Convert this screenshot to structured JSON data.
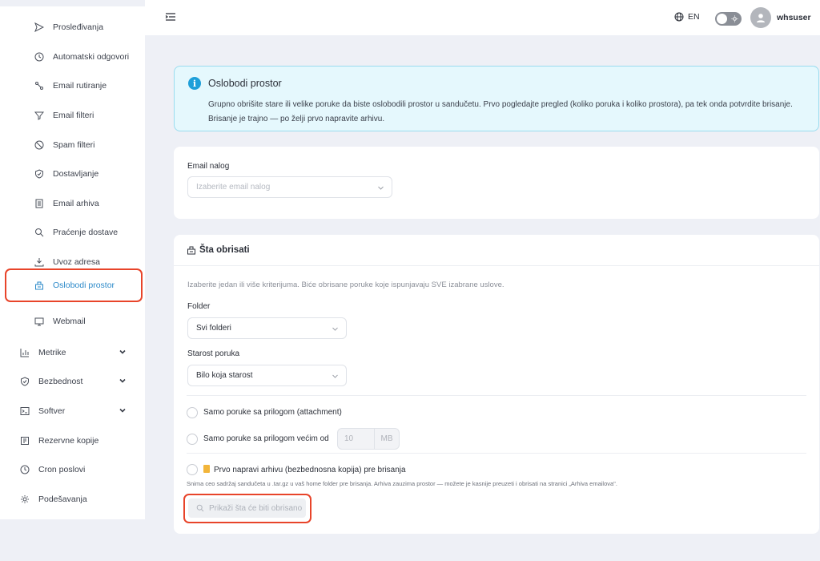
{
  "sidebar": {
    "items": [
      {
        "label": "Prosleđivanja",
        "icon": "send-icon"
      },
      {
        "label": "Automatski odgovori",
        "icon": "clock-icon"
      },
      {
        "label": "Email rutiranje",
        "icon": "route-icon"
      },
      {
        "label": "Email filteri",
        "icon": "filter-icon"
      },
      {
        "label": "Spam filteri",
        "icon": "ban-icon"
      },
      {
        "label": "Dostavljanje",
        "icon": "shield-check-icon"
      },
      {
        "label": "Email arhiva",
        "icon": "archive-icon"
      },
      {
        "label": "Praćenje dostave",
        "icon": "search-icon"
      },
      {
        "label": "Uvoz adresa",
        "icon": "import-icon"
      },
      {
        "label": "Oslobodi prostor",
        "icon": "broom-icon",
        "active": true
      },
      {
        "label": "Webmail",
        "icon": "monitor-icon"
      }
    ],
    "groups": [
      {
        "label": "Metrike",
        "icon": "chart-icon",
        "expandable": true
      },
      {
        "label": "Bezbednost",
        "icon": "shield-icon",
        "expandable": true
      },
      {
        "label": "Softver",
        "icon": "terminal-icon",
        "expandable": true
      },
      {
        "label": "Rezervne kopije",
        "icon": "backup-icon"
      },
      {
        "label": "Cron poslovi",
        "icon": "clock-icon"
      },
      {
        "label": "Podešavanja",
        "icon": "gear-icon"
      }
    ]
  },
  "topbar": {
    "language": "EN",
    "username": "whsuser"
  },
  "alert": {
    "title": "Oslobodi prostor",
    "line1": "Grupno obrišite stare ili velike poruke da biste oslobodili prostor u sandučetu. Prvo pogledajte pregled (koliko poruka i koliko prostora), pa tek onda potvrdite brisanje.",
    "line2": "Brisanje je trajno — po želji prvo napravite arhivu."
  },
  "account": {
    "label": "Email nalog",
    "placeholder": "Izaberite email nalog"
  },
  "criteria": {
    "title": "Šta obrisati",
    "hint": "Izaberite jedan ili više kriterijuma. Biće obrisane poruke koje ispunjavaju SVE izabrane uslove.",
    "folder_label": "Folder",
    "folder_value": "Svi folderi",
    "age_label": "Starost poruka",
    "age_value": "Bilo koja starost",
    "opt_attachment": "Samo poruke sa prilogom (attachment)",
    "opt_larger": "Samo poruke sa prilogom većim od",
    "size_value": "10",
    "size_unit": "MB",
    "opt_archive": "Prvo napravi arhivu (bezbednosna kopija) pre brisanja",
    "archive_note": "Snima ceo sadržaj sandučeta u .tar.gz u vaš home folder pre brisanja. Arhiva zauzima prostor — možete je kasnije preuzeti i obrisati na stranici „Arhiva emailova\".",
    "preview_button": "Prikaži šta će biti obrisano"
  }
}
